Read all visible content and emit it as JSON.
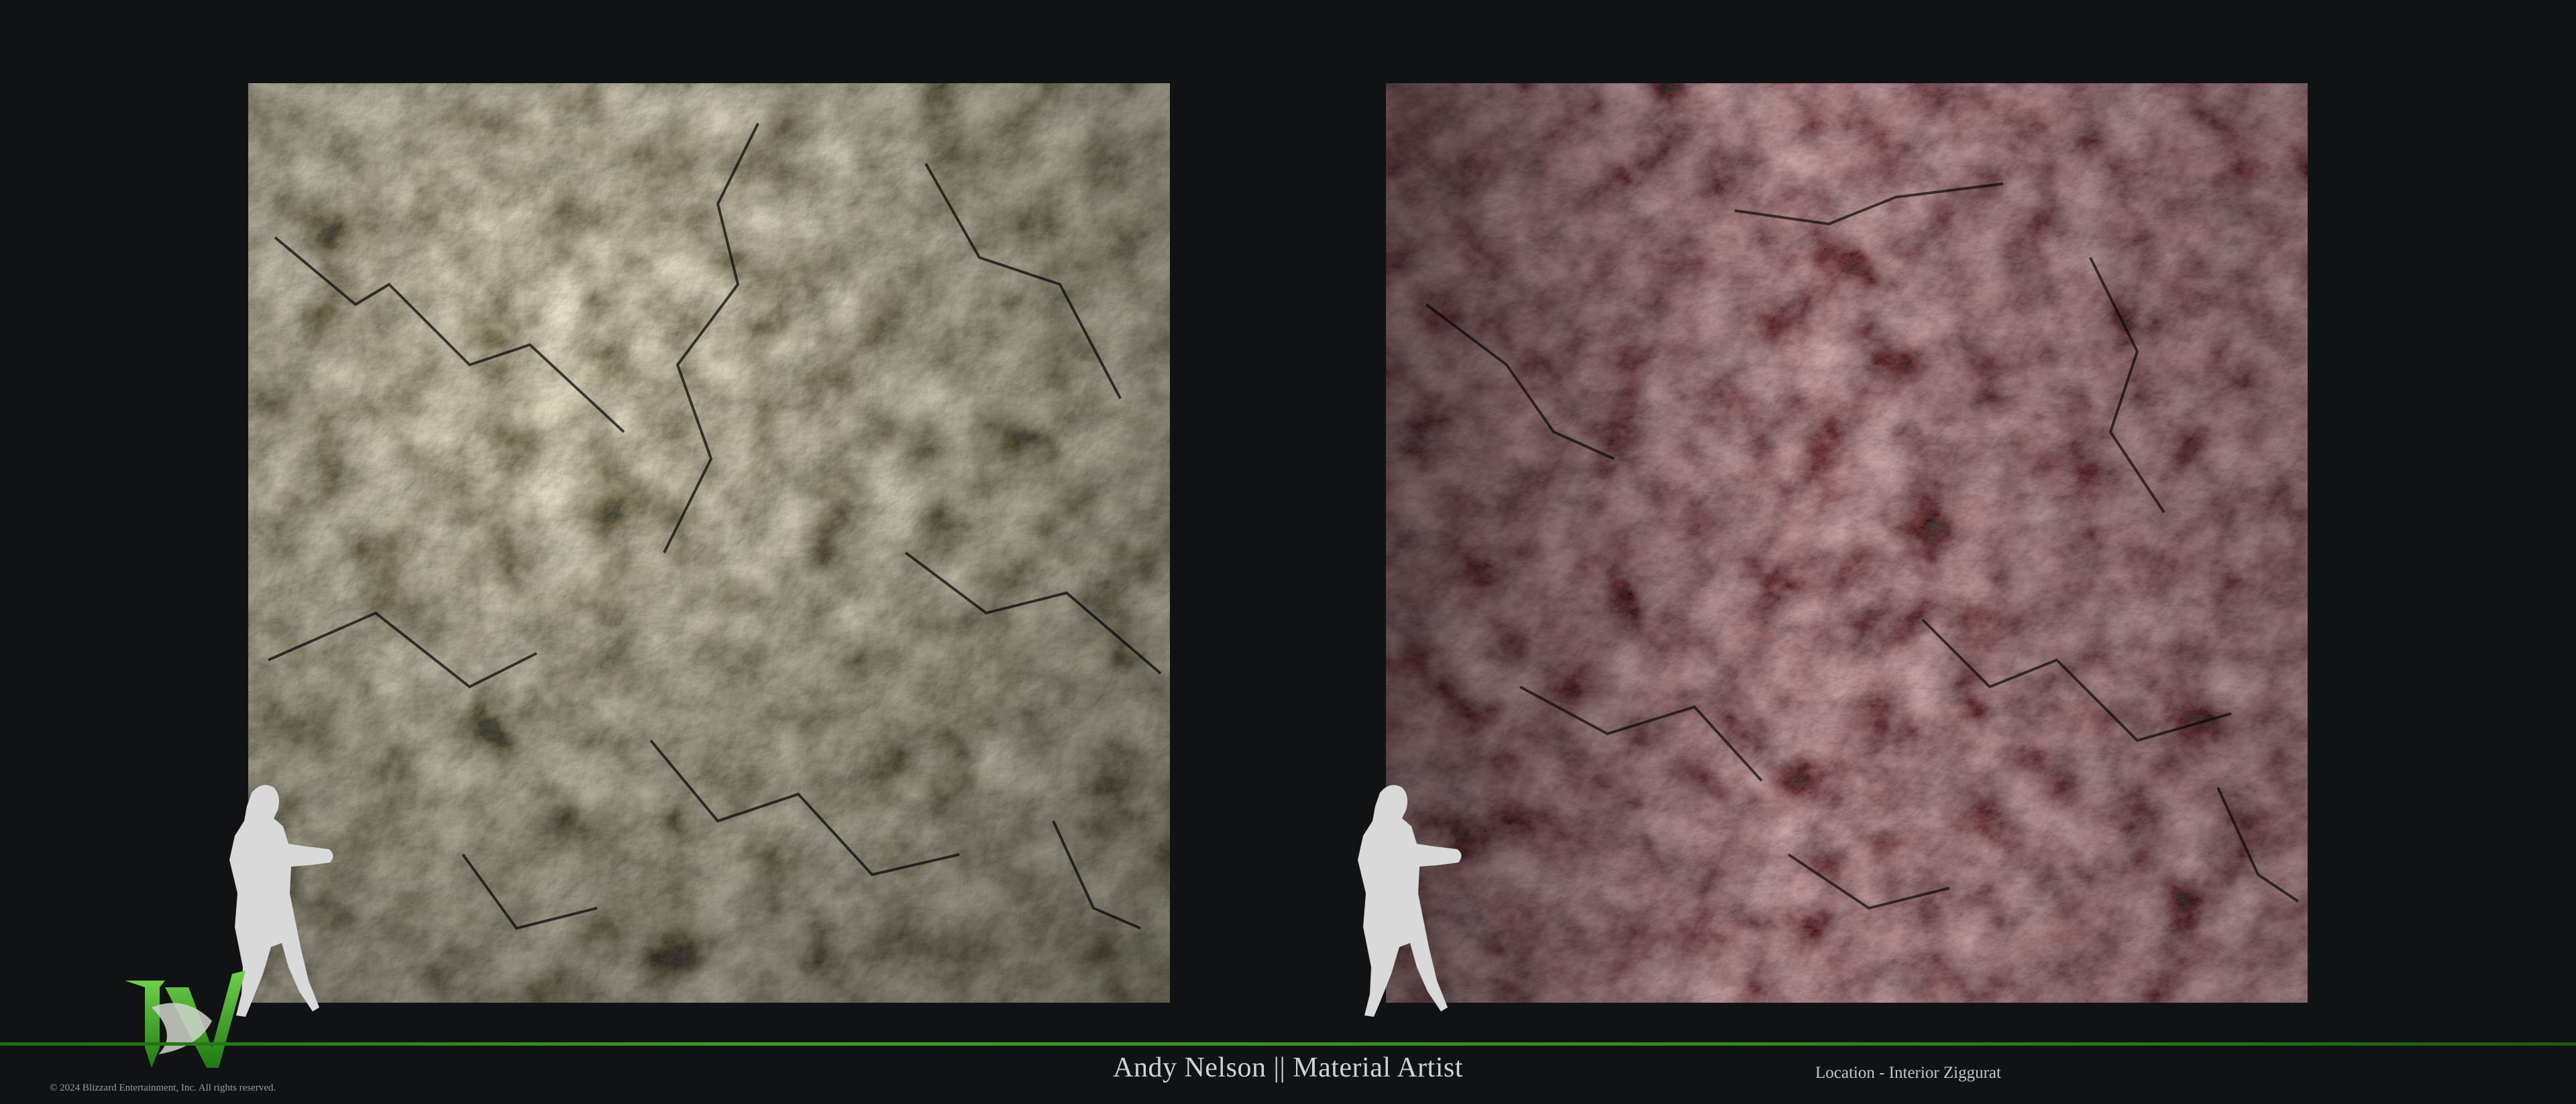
{
  "footer": {
    "artist_credit": "Andy Nelson || Material Artist",
    "location": "Location - Interior Ziggurat",
    "copyright": "© 2024 Blizzard Entertainment, Inc. All rights reserved."
  },
  "logo": {
    "icon": "diablo-iv-logo-icon",
    "text": "IV"
  },
  "materials": [
    {
      "name": "grey-cracked-rock",
      "base_color": "#4f4e4a",
      "highlight": "#b9b3a4",
      "shadow": "#1b1b1a"
    },
    {
      "name": "reddish-cracked-rock",
      "base_color": "#4a3b3c",
      "highlight": "#a98c8c",
      "shadow": "#1e1718"
    }
  ],
  "colors": {
    "background": "#111213",
    "accent_green": "#3d9e22",
    "silhouette": "#d9d9d9"
  }
}
